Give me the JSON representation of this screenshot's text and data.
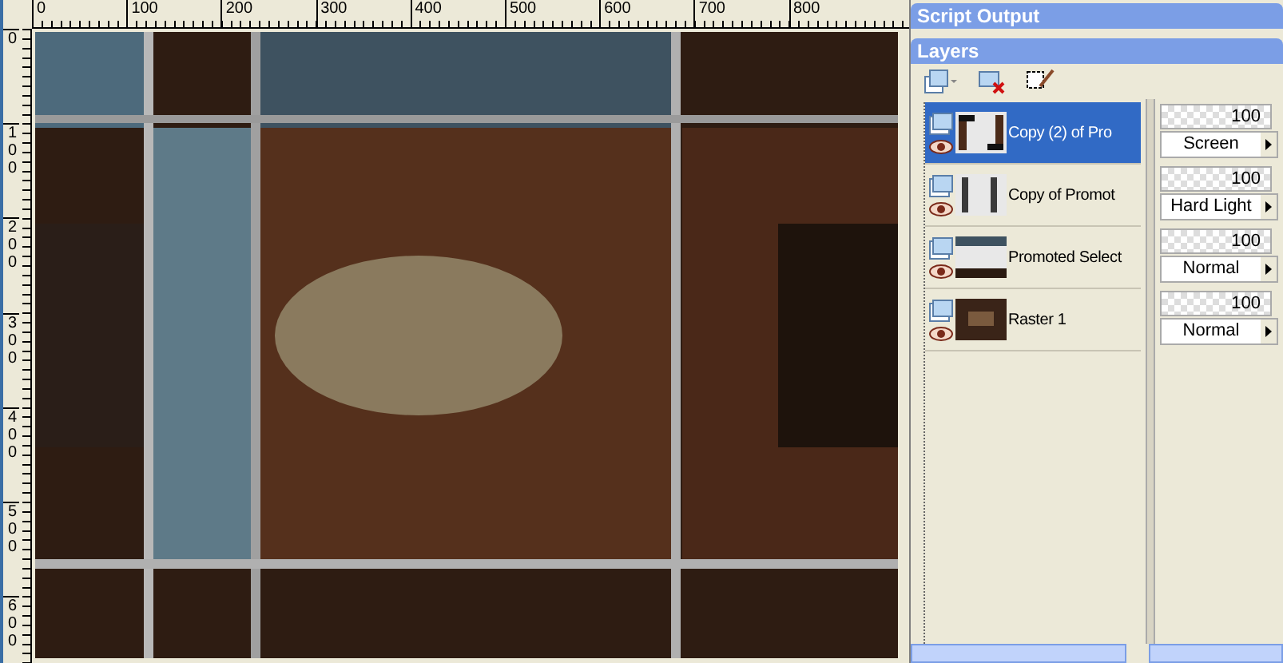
{
  "rulers": {
    "horizontal": [
      "0",
      "100",
      "200",
      "300",
      "400",
      "500",
      "600",
      "700",
      "800"
    ],
    "vertical": [
      "0",
      "100",
      "200",
      "300",
      "400",
      "500",
      "600"
    ]
  },
  "script_output_panel": {
    "title": "Script Output"
  },
  "layers_panel": {
    "title": "Layers",
    "layers": [
      {
        "name": "Copy (2) of Pro",
        "selected": true,
        "opacity": "100",
        "blend_mode": "Screen"
      },
      {
        "name": "Copy of Promot",
        "selected": false,
        "opacity": "100",
        "blend_mode": "Hard Light"
      },
      {
        "name": "Promoted Select",
        "selected": false,
        "opacity": "100",
        "blend_mode": "Normal"
      },
      {
        "name": "Raster 1",
        "selected": false,
        "opacity": "100",
        "blend_mode": "Normal"
      }
    ]
  }
}
